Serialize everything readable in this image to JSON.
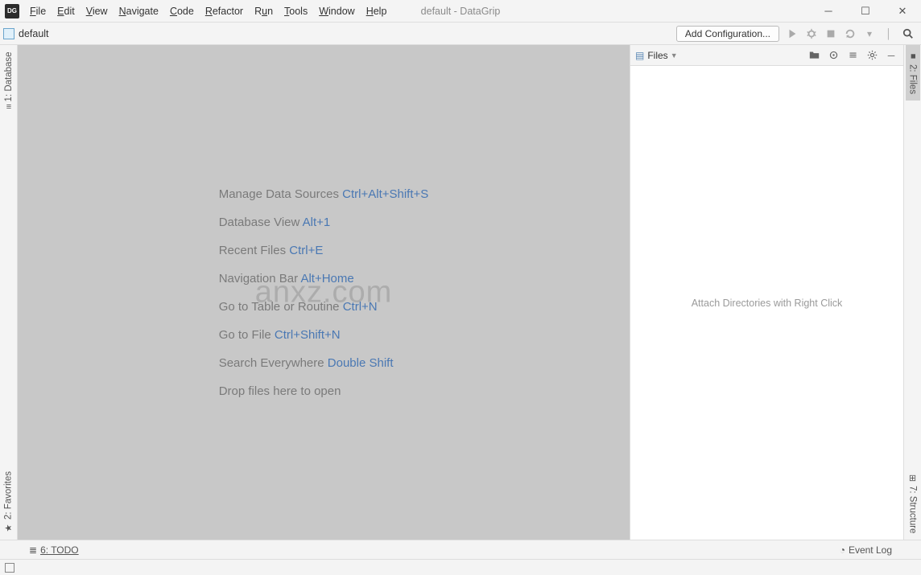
{
  "window": {
    "title": "default - DataGrip",
    "app_badge": "DG"
  },
  "menubar": {
    "file": "File",
    "edit": "Edit",
    "view": "View",
    "navigate": "Navigate",
    "code": "Code",
    "refactor": "Refactor",
    "run": "Run",
    "tools": "Tools",
    "window": "Window",
    "help": "Help"
  },
  "toolbar": {
    "project": "default",
    "add_configuration": "Add Configuration..."
  },
  "left_sidebar": {
    "database": "1: Database",
    "favorites": "2: Favorites"
  },
  "right_sidebar": {
    "files": "2: Files",
    "structure": "7: Structure"
  },
  "editor_tips": [
    {
      "label": "Manage Data Sources",
      "shortcut": "Ctrl+Alt+Shift+S"
    },
    {
      "label": "Database View",
      "shortcut": "Alt+1"
    },
    {
      "label": "Recent Files",
      "shortcut": "Ctrl+E"
    },
    {
      "label": "Navigation Bar",
      "shortcut": "Alt+Home"
    },
    {
      "label": "Go to Table or Routine",
      "shortcut": "Ctrl+N"
    },
    {
      "label": "Go to File",
      "shortcut": "Ctrl+Shift+N"
    },
    {
      "label": "Search Everywhere",
      "shortcut": "Double Shift"
    },
    {
      "label": "Drop files here to open",
      "shortcut": ""
    }
  ],
  "watermark": "anxz.com",
  "files_panel": {
    "title": "Files",
    "empty_text": "Attach Directories with Right Click"
  },
  "bottombar": {
    "todo": "6: TODO",
    "event_log": "Event Log"
  }
}
